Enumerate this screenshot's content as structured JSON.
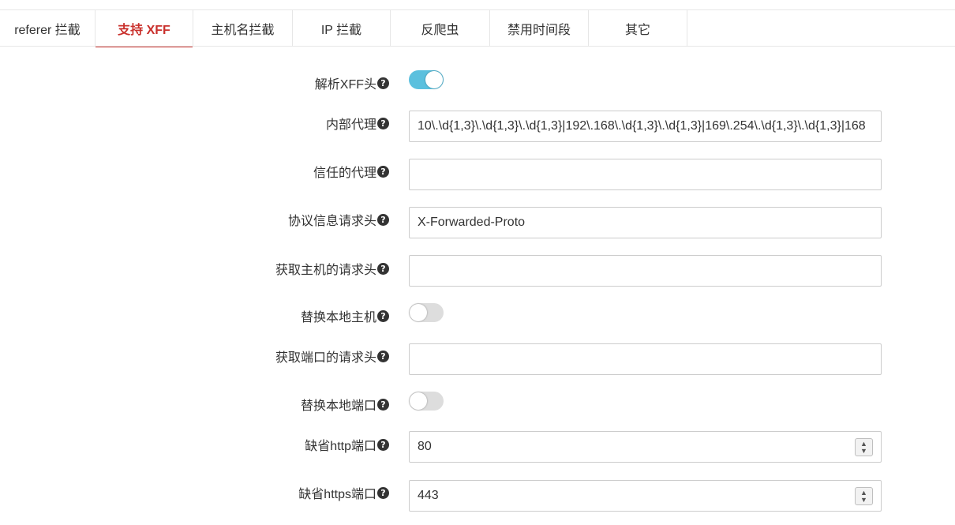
{
  "tabs": [
    {
      "label": "referer 拦截",
      "active": false
    },
    {
      "label": "支持 XFF",
      "active": true
    },
    {
      "label": "主机名拦截",
      "active": false
    },
    {
      "label": "IP 拦截",
      "active": false
    },
    {
      "label": "反爬虫",
      "active": false
    },
    {
      "label": "禁用时间段",
      "active": false
    },
    {
      "label": "其它",
      "active": false
    }
  ],
  "help_icon": "?",
  "spin_up": "▲",
  "spin_down": "▼",
  "fields": {
    "parse_xff": {
      "label": "解析XFF头",
      "on": true
    },
    "internal_proxy": {
      "label": "内部代理",
      "value": "10\\.\\d{1,3}\\.\\d{1,3}\\.\\d{1,3}|192\\.168\\.\\d{1,3}\\.\\d{1,3}|169\\.254\\.\\d{1,3}\\.\\d{1,3}|168"
    },
    "trusted_proxy": {
      "label": "信任的代理",
      "value": ""
    },
    "protocol_header": {
      "label": "协议信息请求头",
      "value": "X-Forwarded-Proto"
    },
    "host_header": {
      "label": "获取主机的请求头",
      "value": ""
    },
    "replace_local_host": {
      "label": "替换本地主机",
      "on": false
    },
    "port_header": {
      "label": "获取端口的请求头",
      "value": ""
    },
    "replace_local_port": {
      "label": "替换本地端口",
      "on": false
    },
    "default_http_port": {
      "label": "缺省http端口",
      "value": "80"
    },
    "default_https_port": {
      "label": "缺省https端口",
      "value": "443"
    }
  },
  "colors": {
    "accent": "#c9302c",
    "switch_on": "#5bc0de",
    "switch_off": "#dddddd"
  }
}
